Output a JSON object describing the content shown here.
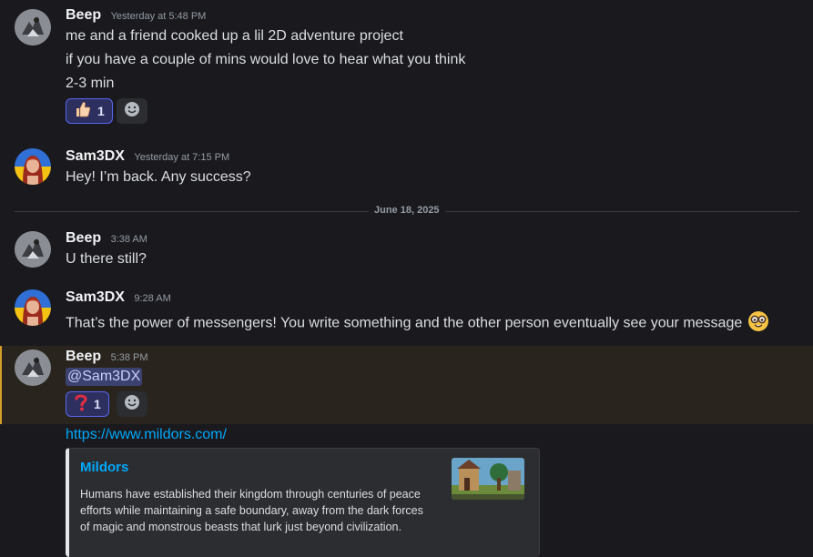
{
  "messages": [
    {
      "username": "Beep",
      "timestamp": "Yesterday at 5:48 PM",
      "lines": [
        "me and a friend cooked up a lil 2D adventure project",
        "if you have a couple of mins would love to hear what you think",
        "2-3 min"
      ],
      "reaction": {
        "icon": "thumbs-up-icon",
        "count": "1"
      }
    },
    {
      "username": "Sam3DX",
      "timestamp": "Yesterday at 7:15 PM",
      "lines": [
        "Hey! I’m back. Any success?"
      ]
    },
    {
      "username": "Beep",
      "timestamp": "3:38 AM",
      "lines": [
        "U there still?"
      ]
    },
    {
      "username": "Sam3DX",
      "timestamp": "9:28 AM",
      "lines": [
        "That’s the power of messengers! You write something and the other person eventually see your message"
      ],
      "emoji": "nerd-face-icon"
    },
    {
      "username": "Beep",
      "timestamp": "5:38 PM",
      "mention": "@Sam3DX",
      "reaction": {
        "icon": "question-mark-icon",
        "count": "1"
      },
      "link": "https://www.mildors.com/",
      "embed": {
        "title": "Mildors",
        "description": "Humans have established their kingdom through centuries of peace efforts while maintaining a safe boundary, away from the dark forces of magic and monstrous beasts that lurk just beyond civilization."
      }
    }
  ],
  "divider": {
    "label": "June 18, 2025"
  },
  "colors": {
    "background": "#1a1a1e",
    "accent": "#5865f2",
    "link": "#00a8fc",
    "highlight_border": "#d59d2b",
    "highlight_bg": "#29251e"
  }
}
